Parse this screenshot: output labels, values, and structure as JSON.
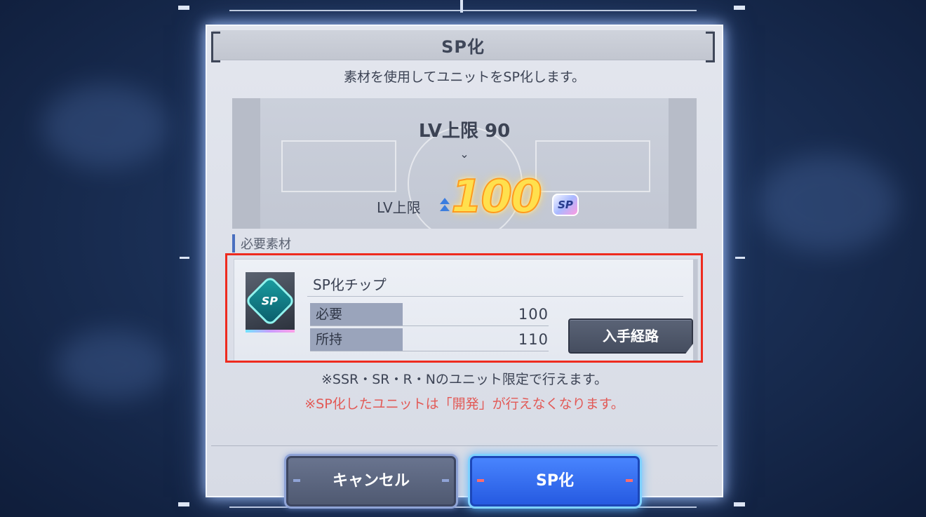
{
  "dialog": {
    "title": "SP化",
    "description": "素材を使用してユニットをSP化します。"
  },
  "level": {
    "before": "LV上限 90",
    "arrow": "⌄",
    "after_label": "LV上限",
    "after_value": "100",
    "sp_badge": "SP"
  },
  "materials": {
    "section_label": "必要素材",
    "item": {
      "name": "SP化チップ",
      "icon": "sp-chip-icon",
      "icon_text": "SP",
      "required_label": "必要",
      "required_value": "100",
      "owned_label": "所持",
      "owned_value": "110",
      "route_button": "入手経路"
    }
  },
  "notes": {
    "limit": "※SSR・SR・R・Nのユニット限定で行えます。",
    "warning": "※SP化したユニットは「開発」が行えなくなります。"
  },
  "buttons": {
    "cancel": "キャンセル",
    "confirm": "SP化"
  },
  "colors": {
    "warning_text": "#e25a57",
    "highlight_box": "#ee2b1f",
    "confirm_button": "#2458e0",
    "level_value": "#ffe04d"
  }
}
